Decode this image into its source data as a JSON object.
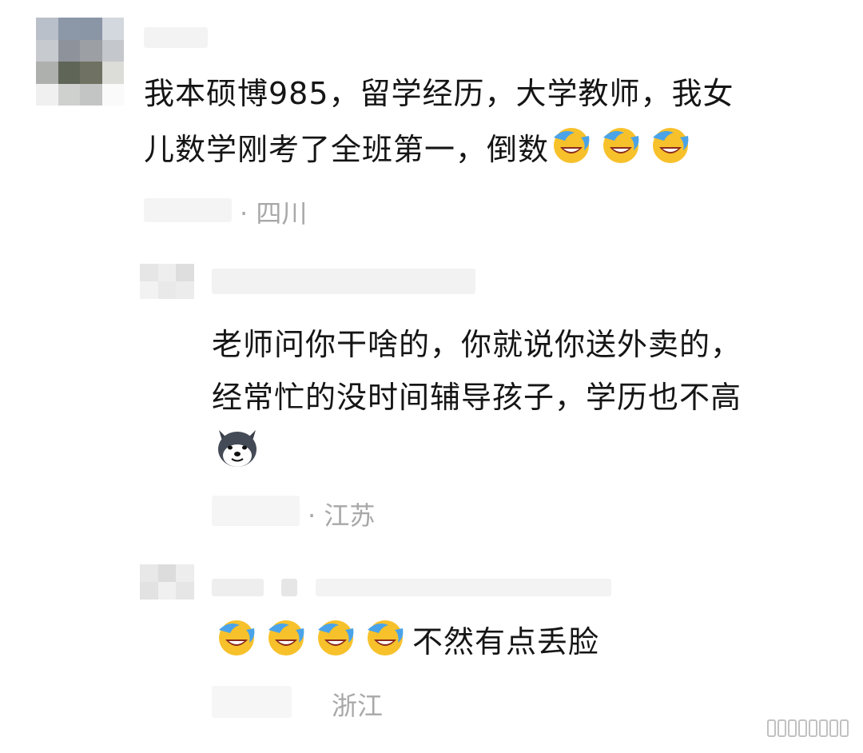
{
  "comments": [
    {
      "text_line1": "我本硕博985，留学经历，大学教师，我女",
      "text_line2": "儿数学刚考了全班第一，倒数",
      "emoji_count": 3,
      "emoji_name": "crying-laughing-icon",
      "location": "· 四川"
    },
    {
      "text_line1": "老师问你干啥的，你就说你送外卖的，",
      "text_line2": "经常忙的没时间辅导孩子，学历也不高",
      "emoji_name": "husky-dog-icon",
      "location": "· 江苏"
    },
    {
      "leading_emoji_count": 4,
      "emoji_name": "crying-laughing-icon",
      "text": "不然有点丢脸",
      "location": "浙江"
    }
  ]
}
